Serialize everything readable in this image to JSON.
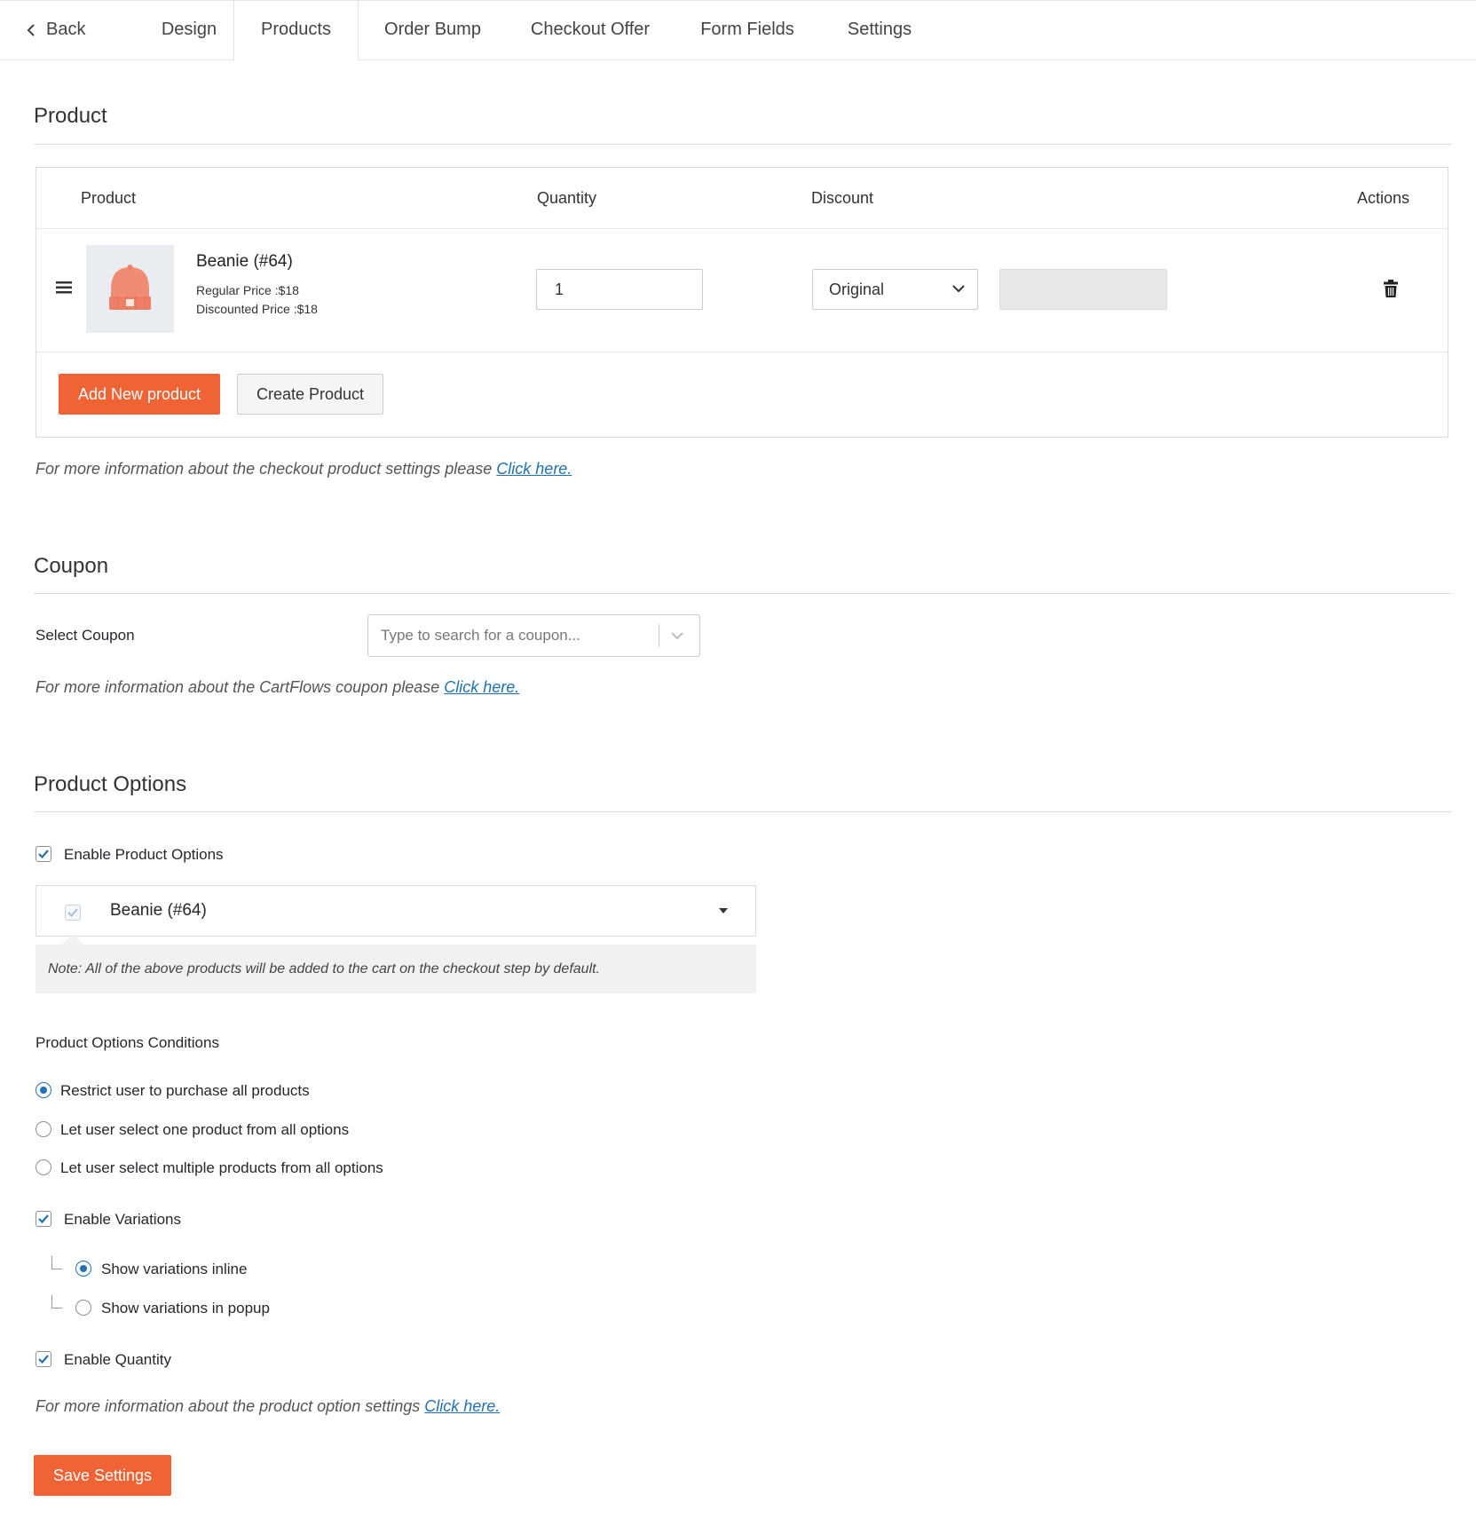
{
  "tabs": {
    "back": "Back",
    "design": "Design",
    "products": "Products",
    "order_bump": "Order Bump",
    "checkout_offer": "Checkout Offer",
    "form_fields": "Form Fields",
    "settings": "Settings",
    "active": "Products"
  },
  "product_section": {
    "title": "Product",
    "columns": {
      "product": "Product",
      "quantity": "Quantity",
      "discount": "Discount",
      "actions": "Actions"
    },
    "rows": [
      {
        "name": "Beanie (#64)",
        "regular_price": "Regular Price :$18",
        "discounted_price": "Discounted Price :$18",
        "quantity": "1",
        "discount_type": "Original",
        "discount_value": "",
        "thumbnail": "beanie-image"
      }
    ],
    "add_button": "Add New product",
    "create_button": "Create Product",
    "info_text": "For more information about the checkout product settings please ",
    "info_link": "Click here."
  },
  "coupon_section": {
    "title": "Coupon",
    "select_label": "Select Coupon",
    "placeholder": "Type to search for a coupon...",
    "info_text": "For more information about the CartFlows coupon please ",
    "info_link": "Click here."
  },
  "options_section": {
    "title": "Product Options",
    "enable_options_label": "Enable Product Options",
    "enable_options_checked": true,
    "option_product": "Beanie (#64)",
    "note": "Note: All of the above products will be added to the cart on the checkout step by default.",
    "conditions_title": "Product Options Conditions",
    "conditions": [
      {
        "label": "Restrict user to purchase all products",
        "selected": true
      },
      {
        "label": "Let user select one product from all options",
        "selected": false
      },
      {
        "label": "Let user select multiple products from all options",
        "selected": false
      }
    ],
    "enable_variations_label": "Enable Variations",
    "enable_variations_checked": true,
    "variation_modes": [
      {
        "label": "Show variations inline",
        "selected": true
      },
      {
        "label": "Show variations in popup",
        "selected": false
      }
    ],
    "enable_quantity_label": "Enable Quantity",
    "enable_quantity_checked": true,
    "info_text": "For more information about the product option settings ",
    "info_link": "Click here."
  },
  "save_button": "Save Settings",
  "colors": {
    "accent": "#f06335",
    "link": "#2271b1",
    "checkbox": "#2271b1",
    "beanie": "#f08c73"
  },
  "icons": [
    "chevron-left-icon",
    "drag-handle-icon",
    "chevron-down-icon",
    "trash-icon",
    "check-icon",
    "caret-down-icon"
  ]
}
